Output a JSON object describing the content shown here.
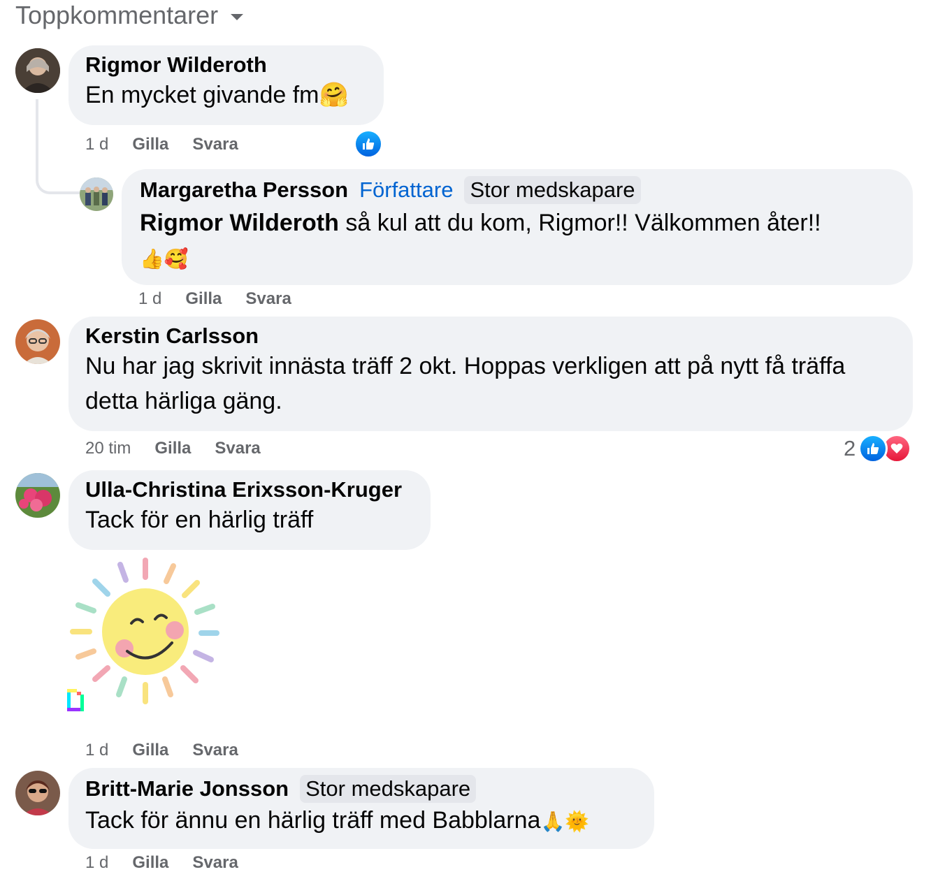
{
  "sort_label": "Toppkommentarer",
  "comments": [
    {
      "name": "Rigmor Wilderoth",
      "text": "En mycket givande fm",
      "emoji": "🤗",
      "time": "1 d",
      "like": "Gilla",
      "reply": "Svara"
    },
    {
      "name": "Margaretha Persson",
      "badge_author": "Författare",
      "badge": "Stor medskapare",
      "mention": "Rigmor Wilderoth",
      "text": " så kul att du kom, Rigmor!! Välkommen åter!!",
      "emoji": "👍🥰",
      "time": "1 d",
      "like": "Gilla",
      "reply": "Svara"
    },
    {
      "name": "Kerstin Carlsson",
      "text": "Nu har jag skrivit innästa träff 2 okt. Hoppas verkligen att på nytt få träffa detta härliga gäng.",
      "time": "20 tim",
      "like": "Gilla",
      "reply": "Svara",
      "reaction_count": "2"
    },
    {
      "name": "Ulla-Christina Erixsson-Kruger",
      "text": "Tack för en härlig träff",
      "time": "1 d",
      "like": "Gilla",
      "reply": "Svara"
    },
    {
      "name": "Britt-Marie Jonsson",
      "badge": "Stor medskapare",
      "text": "Tack för ännu en härlig träff med Babblarna",
      "emoji": "🙏🌞",
      "time": "1 d",
      "like": "Gilla",
      "reply": "Svara"
    }
  ],
  "colors": {
    "bubble": "#f0f2f5",
    "meta": "#65676b",
    "author_blue": "#0064d1",
    "like_blue": "#0866ff",
    "love_red": "#f33e58"
  }
}
